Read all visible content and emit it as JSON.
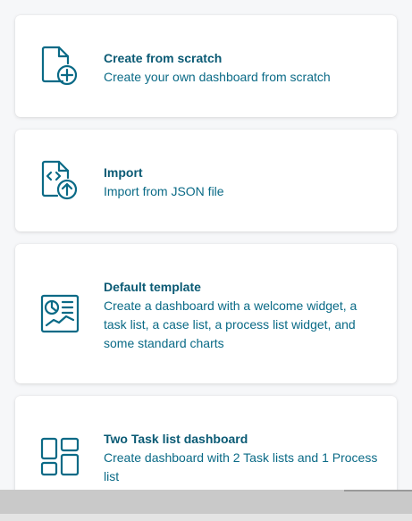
{
  "cards": [
    {
      "icon": "file-plus-icon",
      "title": "Create from scratch",
      "description": "Create your own dashboard from scratch"
    },
    {
      "icon": "file-code-upload-icon",
      "title": "Import",
      "description": "Import from JSON file"
    },
    {
      "icon": "chart-template-icon",
      "title": "Default template",
      "description": "Create a dashboard with a welcome widget, a task list, a case list, a process list widget, and some standard charts"
    },
    {
      "icon": "layout-grid-icon",
      "title": "Two Task list dashboard",
      "description": "Create dashboard with 2 Task lists and 1 Process list"
    }
  ],
  "colors": {
    "accent": "#0a6a86",
    "title": "#0a5a74",
    "background": "#f6f7f9",
    "card": "#ffffff"
  }
}
